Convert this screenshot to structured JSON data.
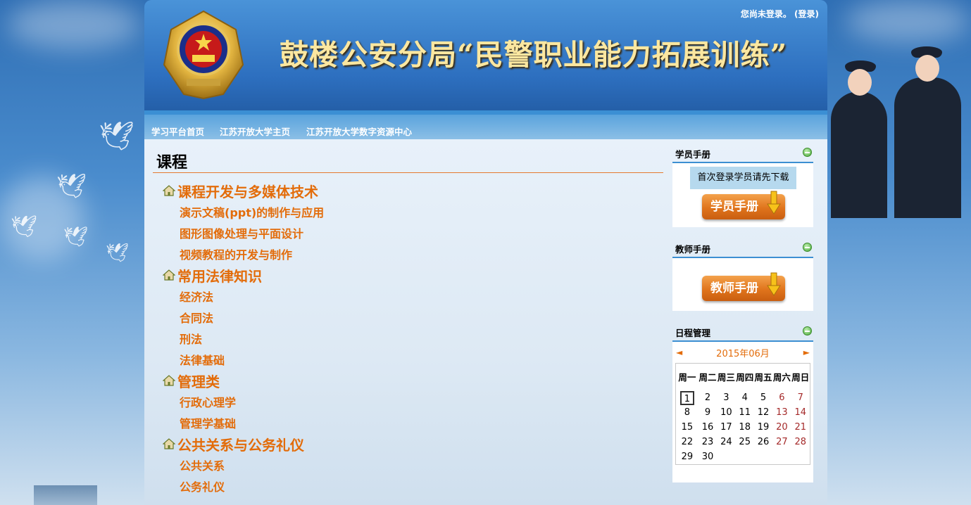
{
  "header": {
    "title": "鼓楼公安分局“民警职业能力拓展训练”",
    "login_text": "您尚未登录。",
    "login_link": "(登录)"
  },
  "nav": {
    "items": [
      {
        "label": "学习平台首页"
      },
      {
        "label": "江苏开放大学主页"
      },
      {
        "label": "江苏开放大学数字资源中心"
      }
    ]
  },
  "main": {
    "heading": "课程",
    "categories": [
      {
        "label": "课程开发与多媒体技术",
        "courses": [
          "演示文稿(ppt)的制作与应用",
          "图形图像处理与平面设计",
          "视频教程的开发与制作"
        ]
      },
      {
        "label": "常用法律知识",
        "courses": [
          "经济法",
          "合同法",
          "刑法",
          "法律基础"
        ]
      },
      {
        "label": "管理类",
        "courses": [
          "行政心理学",
          "管理学基础"
        ]
      },
      {
        "label": "公共关系与公务礼仪",
        "courses": [
          "公共关系",
          "公务礼仪"
        ]
      }
    ]
  },
  "sidebar": {
    "student_manual": {
      "title": "学员手册",
      "notice": "首次登录学员请先下载",
      "button": "学员手册"
    },
    "teacher_manual": {
      "title": "教师手册",
      "button": "教师手册"
    },
    "calendar": {
      "title": "日程管理",
      "month": "2015年06月",
      "prev": "◄",
      "next": "►",
      "weekdays": [
        "周一",
        "周二",
        "周三",
        "周四",
        "周五",
        "周六",
        "周日"
      ],
      "weeks": [
        [
          "1",
          "2",
          "3",
          "4",
          "5",
          "6",
          "7"
        ],
        [
          "8",
          "9",
          "10",
          "11",
          "12",
          "13",
          "14"
        ],
        [
          "15",
          "16",
          "17",
          "18",
          "19",
          "20",
          "21"
        ],
        [
          "22",
          "23",
          "24",
          "25",
          "26",
          "27",
          "28"
        ],
        [
          "29",
          "30",
          "",
          "",
          "",
          "",
          ""
        ]
      ],
      "today": "1"
    }
  },
  "colors": {
    "accent_orange": "#e36c0a",
    "header_blue": "#2d6fbf",
    "title_gold": "#fbe7a0"
  }
}
